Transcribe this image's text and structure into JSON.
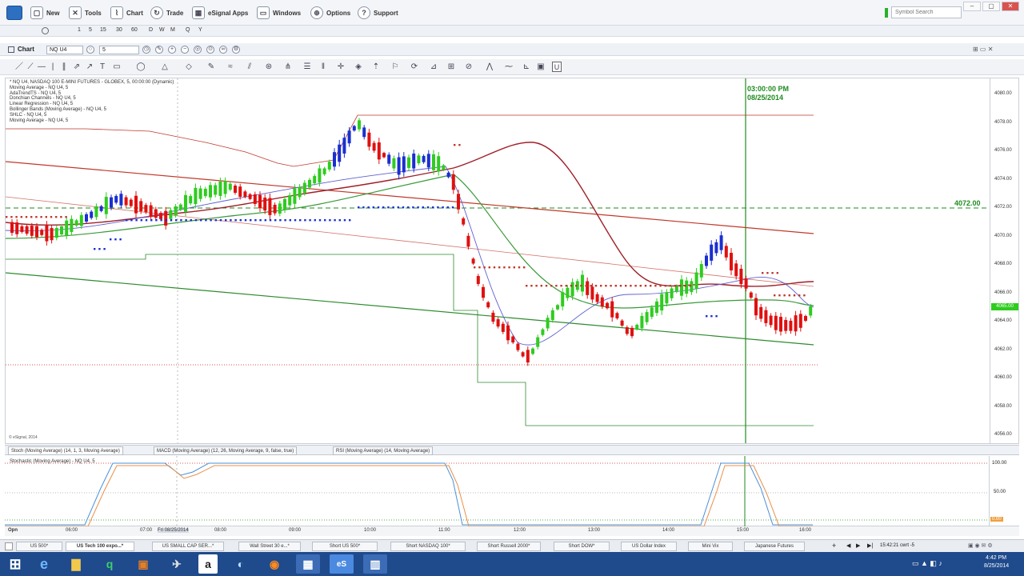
{
  "menu": {
    "items": [
      "New",
      "Tools",
      "Chart",
      "Trade",
      "eSignal Apps",
      "Windows",
      "Options",
      "Support"
    ],
    "search_placeholder": "Symbol Search"
  },
  "intervals": [
    "1",
    "5",
    "15",
    "30",
    "60",
    "D",
    "W",
    "M",
    "Q",
    "Y"
  ],
  "chart_window": {
    "title": "Chart",
    "symbol": "NQ U4",
    "interval": "5"
  },
  "study_list": [
    "* NQ U4, NASDAQ 100 E-MINI FUTURES - GLOBEX, 5, 00:00:00 (Dynamic)",
    "Moving Average - NQ U4, 5",
    "AdaTrendTS - NQ U4, 5",
    "Donchian Channels - NQ U4, 5",
    "Linear Regression - NQ U4, 5",
    "Bollinger Bands (Moving Average) - NQ U4, 5",
    "SHLC - NQ U4, 5",
    "Moving Average - NQ U4, 5"
  ],
  "cursor_readout": {
    "time": "03:00:00 PM",
    "date": "08/25/2014"
  },
  "price_line_label": "4072.00",
  "copyright": "© eSignal, 2014",
  "price_axis": [
    "4080.00",
    "4078.00",
    "4076.00",
    "4074.00",
    "4072.00",
    "4070.00",
    "4068.00",
    "4066.00",
    "4064.00",
    "4062.00",
    "4060.00",
    "4058.00",
    "4056.00"
  ],
  "current_price_label": "4065.00",
  "study_tabs": [
    "Stoch (Moving Average) (14, 1, 3, Moving Average)",
    "MACD (Moving Average) (12, 26, Moving Average, 9, false, true)",
    "RSI (Moving Average) (14, Moving Average)"
  ],
  "lower_pane_title": "Stochastic (Moving Average) - NQ U4, 5",
  "lower_axis": [
    "100.00",
    "50.00",
    "0.00"
  ],
  "time_axis": [
    "Opn",
    "06:00",
    "07:00",
    "Fri 08/25/2014",
    "08:00",
    "09:00",
    "10:00",
    "11:00",
    "12:00",
    "13:00",
    "14:00",
    "15:00",
    "16:00"
  ],
  "page_tabs": [
    "US 500*",
    "US Tech 100 expo...*",
    "US SMALL CAP SER...*",
    "Wall Street 30 e...*",
    "Short US 500*",
    "Short NASDAQ 100*",
    "Short Russell 2000*",
    "Short DOW*",
    "US Dollar Index",
    "Mini Vix",
    "Japanese Futures"
  ],
  "status_right": "15:42:21 cwrt -5",
  "clock": {
    "time": "4:42 PM",
    "date": "8/25/2014"
  },
  "colors": {
    "up_bar": "#2ecc1f",
    "down_bar": "#e01010",
    "blue_bar": "#1a2fd0",
    "cursor_line": "#1f8a1f",
    "accent": "#1f4a8c"
  }
}
